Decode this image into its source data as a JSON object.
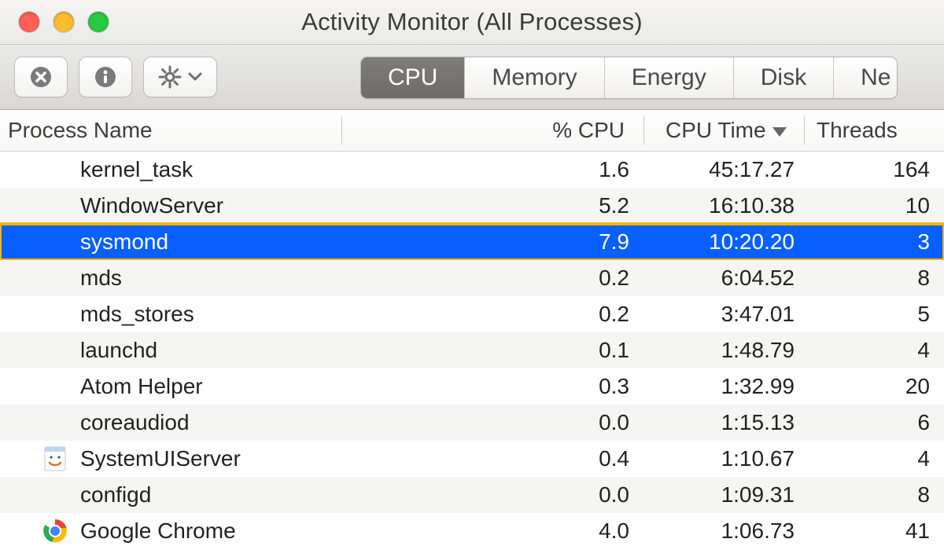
{
  "window": {
    "title": "Activity Monitor (All Processes)"
  },
  "tabs": {
    "cpu": "CPU",
    "memory": "Memory",
    "energy": "Energy",
    "disk": "Disk",
    "network": "Ne",
    "active": "cpu"
  },
  "columns": {
    "name": "Process Name",
    "cpu": "% CPU",
    "time": "CPU Time",
    "threads": "Threads",
    "sort": "time"
  },
  "processes": [
    {
      "name": "kernel_task",
      "cpu": "1.6",
      "time": "45:17.27",
      "threads": "164",
      "icon": null
    },
    {
      "name": "WindowServer",
      "cpu": "5.2",
      "time": "16:10.38",
      "threads": "10",
      "icon": null
    },
    {
      "name": "sysmond",
      "cpu": "7.9",
      "time": "10:20.20",
      "threads": "3",
      "icon": null,
      "selected": true
    },
    {
      "name": "mds",
      "cpu": "0.2",
      "time": "6:04.52",
      "threads": "8",
      "icon": null
    },
    {
      "name": "mds_stores",
      "cpu": "0.2",
      "time": "3:47.01",
      "threads": "5",
      "icon": null
    },
    {
      "name": "launchd",
      "cpu": "0.1",
      "time": "1:48.79",
      "threads": "4",
      "icon": null
    },
    {
      "name": "Atom Helper",
      "cpu": "0.3",
      "time": "1:32.99",
      "threads": "20",
      "icon": null
    },
    {
      "name": "coreaudiod",
      "cpu": "0.0",
      "time": "1:15.13",
      "threads": "6",
      "icon": null
    },
    {
      "name": "SystemUIServer",
      "cpu": "0.4",
      "time": "1:10.67",
      "threads": "4",
      "icon": "finder"
    },
    {
      "name": "configd",
      "cpu": "0.0",
      "time": "1:09.31",
      "threads": "8",
      "icon": null
    },
    {
      "name": "Google Chrome",
      "cpu": "4.0",
      "time": "1:06.73",
      "threads": "41",
      "icon": "chrome"
    }
  ]
}
